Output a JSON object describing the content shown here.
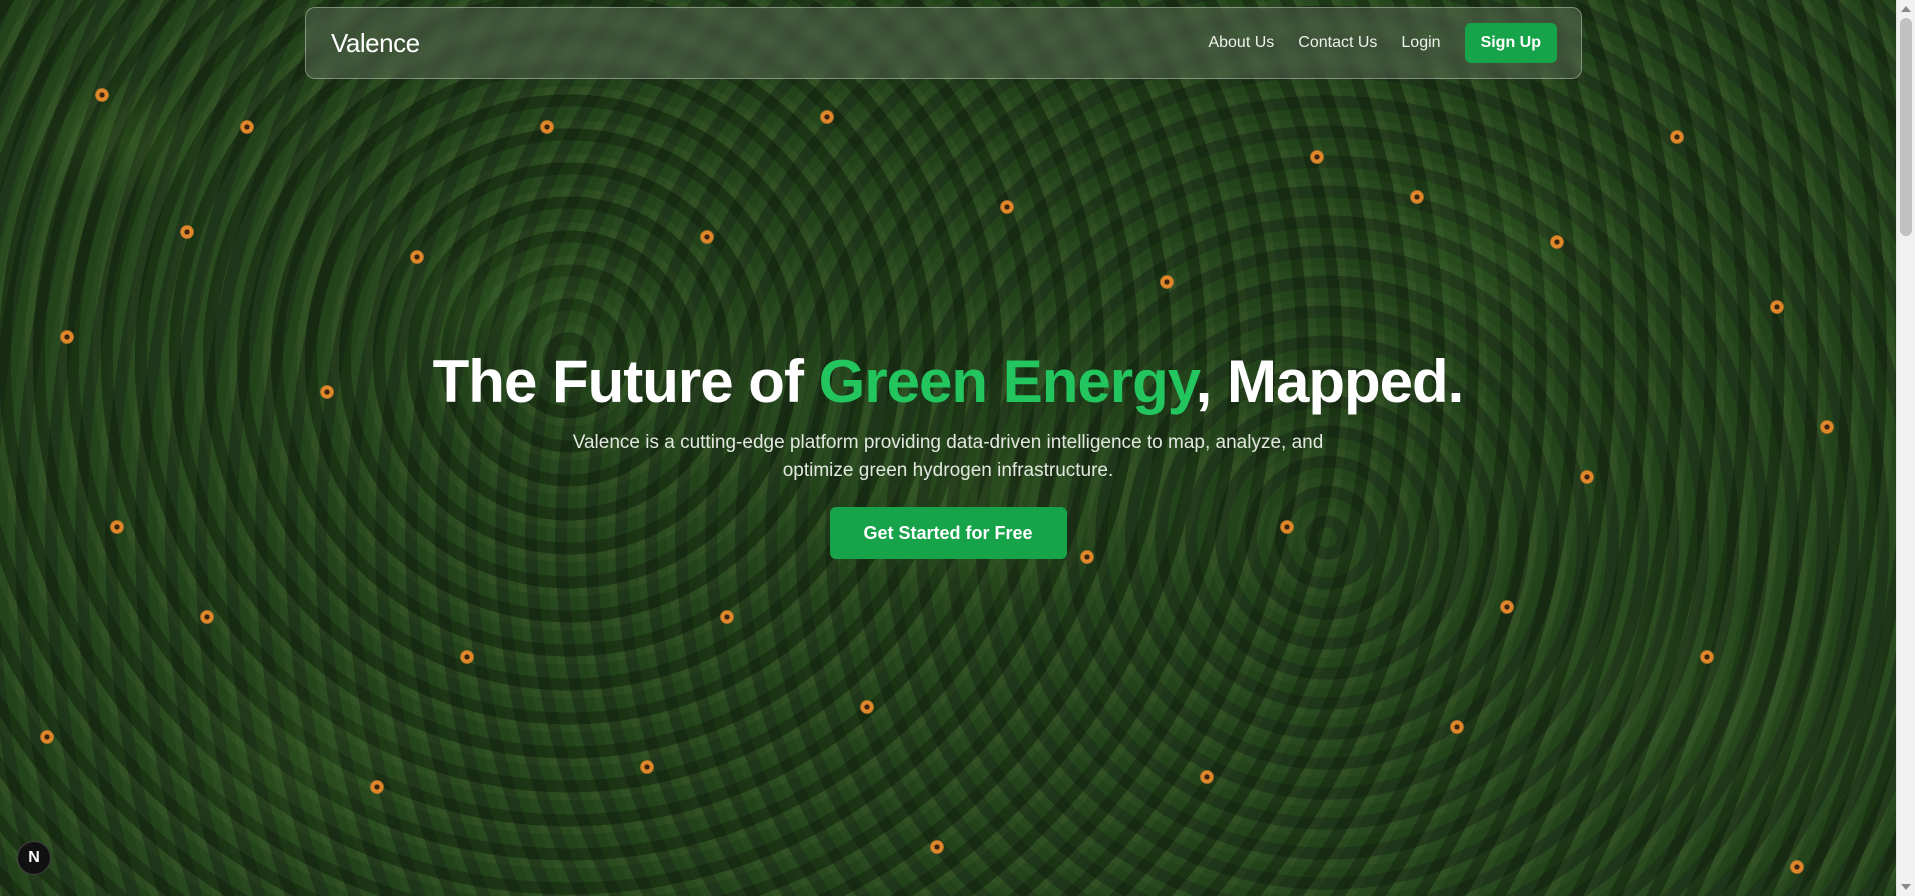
{
  "nav": {
    "brand": "Valence",
    "links": [
      "About Us",
      "Contact Us",
      "Login"
    ],
    "signup_label": "Sign Up"
  },
  "hero": {
    "title_part1": "The Future of ",
    "title_accent": "Green Energy",
    "title_part2": ", Mapped.",
    "subtitle": "Valence is a cutting-edge platform providing data-driven intelligence to map, analyze, and optimize green hydrogen infrastructure.",
    "cta_label": "Get Started for Free"
  },
  "badge": {
    "letter": "N"
  },
  "colors": {
    "accent": "#22c55e",
    "button": "#16a34a"
  }
}
